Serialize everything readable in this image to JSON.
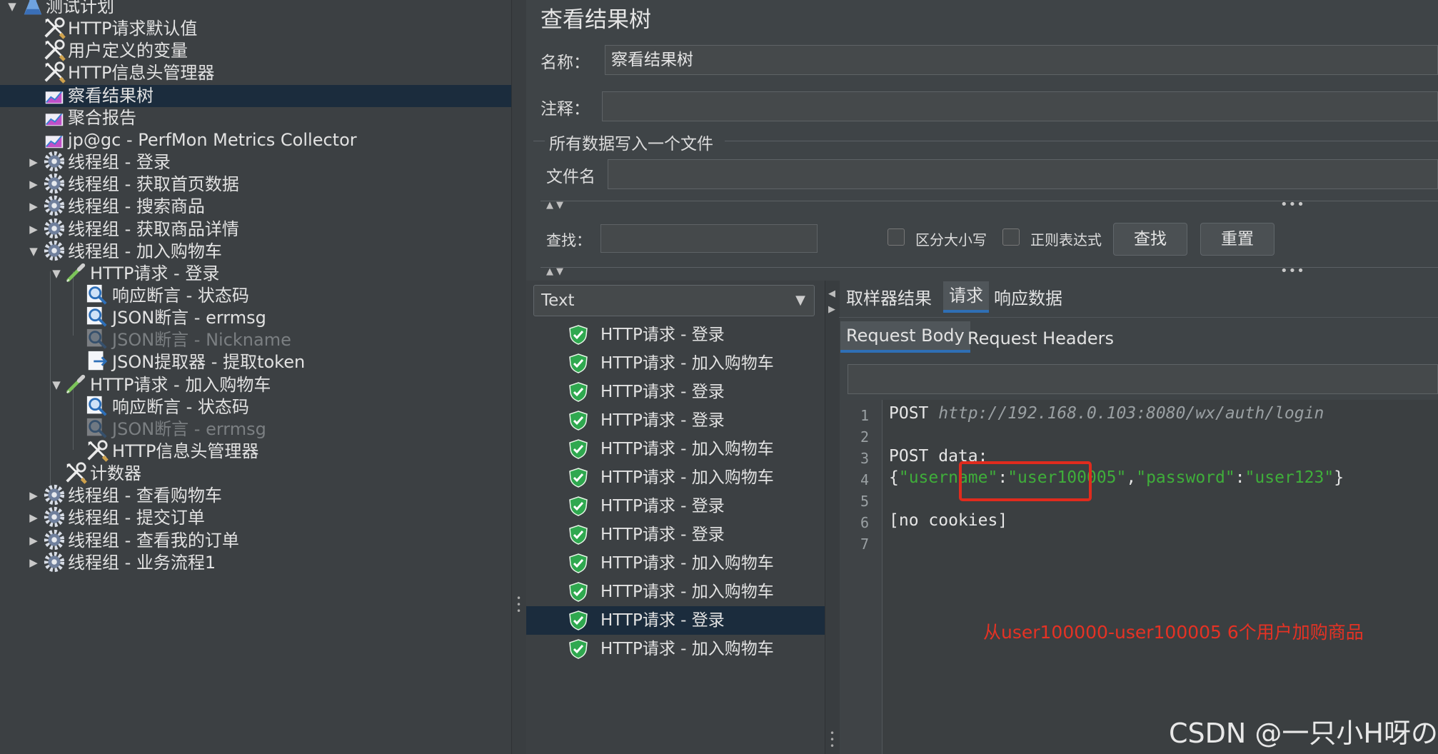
{
  "tree": {
    "items": [
      {
        "label": "测试计划",
        "icon": "flask-icon",
        "level": 0,
        "toggle": "expanded",
        "state": "normal"
      },
      {
        "label": "HTTP请求默认值",
        "icon": "tools-icon",
        "level": 1,
        "toggle": "none",
        "state": "normal"
      },
      {
        "label": "用户定义的变量",
        "icon": "tools-icon",
        "level": 1,
        "toggle": "none",
        "state": "normal"
      },
      {
        "label": "HTTP信息头管理器",
        "icon": "tools-icon",
        "level": 1,
        "toggle": "none",
        "state": "normal"
      },
      {
        "label": "察看结果树",
        "icon": "chart-icon",
        "level": 1,
        "toggle": "none",
        "state": "selected"
      },
      {
        "label": "聚合报告",
        "icon": "chart-icon",
        "level": 1,
        "toggle": "none",
        "state": "normal"
      },
      {
        "label": "jp@gc - PerfMon Metrics Collector",
        "icon": "chart-icon",
        "level": 1,
        "toggle": "none",
        "state": "normal"
      },
      {
        "label": "线程组 - 登录",
        "icon": "gear-icon",
        "level": 1,
        "toggle": "collapsed",
        "state": "normal"
      },
      {
        "label": "线程组 - 获取首页数据",
        "icon": "gear-icon",
        "level": 1,
        "toggle": "collapsed",
        "state": "normal"
      },
      {
        "label": "线程组 - 搜索商品",
        "icon": "gear-icon",
        "level": 1,
        "toggle": "collapsed",
        "state": "normal"
      },
      {
        "label": "线程组 - 获取商品详情",
        "icon": "gear-icon",
        "level": 1,
        "toggle": "collapsed",
        "state": "normal"
      },
      {
        "label": "线程组 - 加入购物车",
        "icon": "gear-icon",
        "level": 1,
        "toggle": "expanded",
        "state": "normal"
      },
      {
        "label": "HTTP请求 - 登录",
        "icon": "pipette-icon",
        "level": 2,
        "toggle": "expanded",
        "state": "normal"
      },
      {
        "label": "响应断言 - 状态码",
        "icon": "magnifier-icon",
        "level": 3,
        "toggle": "none",
        "state": "normal"
      },
      {
        "label": "JSON断言 - errmsg",
        "icon": "magnifier-icon",
        "level": 3,
        "toggle": "none",
        "state": "normal"
      },
      {
        "label": "JSON断言 - Nickname",
        "icon": "magnifier-icon",
        "level": 3,
        "toggle": "none",
        "state": "disabled"
      },
      {
        "label": "JSON提取器 - 提取token",
        "icon": "extractor-icon",
        "level": 3,
        "toggle": "none",
        "state": "normal"
      },
      {
        "label": "HTTP请求 - 加入购物车",
        "icon": "pipette-icon",
        "level": 2,
        "toggle": "expanded",
        "state": "normal"
      },
      {
        "label": "响应断言 - 状态码",
        "icon": "magnifier-icon",
        "level": 3,
        "toggle": "none",
        "state": "normal"
      },
      {
        "label": "JSON断言 - errmsg",
        "icon": "magnifier-icon",
        "level": 3,
        "toggle": "none",
        "state": "disabled"
      },
      {
        "label": "HTTP信息头管理器",
        "icon": "tools-icon",
        "level": 3,
        "toggle": "none",
        "state": "normal"
      },
      {
        "label": "计数器",
        "icon": "tools-icon",
        "level": 2,
        "toggle": "none",
        "state": "normal"
      },
      {
        "label": "线程组 - 查看购物车",
        "icon": "gear-icon",
        "level": 1,
        "toggle": "collapsed",
        "state": "normal"
      },
      {
        "label": "线程组 - 提交订单",
        "icon": "gear-icon",
        "level": 1,
        "toggle": "collapsed",
        "state": "normal"
      },
      {
        "label": "线程组 - 查看我的订单",
        "icon": "gear-icon",
        "level": 1,
        "toggle": "collapsed",
        "state": "normal"
      },
      {
        "label": "线程组 - 业务流程1",
        "icon": "gear-icon",
        "level": 1,
        "toggle": "collapsed",
        "state": "normal"
      }
    ]
  },
  "panel": {
    "title": "查看结果树",
    "name_label": "名称：",
    "name_value": "察看结果树",
    "comment_label": "注释：",
    "comment_value": "",
    "file_section_label": "所有数据写入一个文件",
    "filename_label": "文件名",
    "filename_value": ""
  },
  "search": {
    "label": "查找：",
    "value": "",
    "case_sensitive_label": "区分大小写",
    "regex_label": "正则表达式",
    "find_button": "查找",
    "reset_button": "重置"
  },
  "results": {
    "renderer": "Text",
    "items": [
      {
        "label": "HTTP请求 - 登录",
        "selected": false
      },
      {
        "label": "HTTP请求 - 加入购物车",
        "selected": false
      },
      {
        "label": "HTTP请求 - 登录",
        "selected": false
      },
      {
        "label": "HTTP请求 - 登录",
        "selected": false
      },
      {
        "label": "HTTP请求 - 加入购物车",
        "selected": false
      },
      {
        "label": "HTTP请求 - 加入购物车",
        "selected": false
      },
      {
        "label": "HTTP请求 - 登录",
        "selected": false
      },
      {
        "label": "HTTP请求 - 登录",
        "selected": false
      },
      {
        "label": "HTTP请求 - 加入购物车",
        "selected": false
      },
      {
        "label": "HTTP请求 - 加入购物车",
        "selected": false
      },
      {
        "label": "HTTP请求 - 登录",
        "selected": true
      },
      {
        "label": "HTTP请求 - 加入购物车",
        "selected": false
      }
    ]
  },
  "detail": {
    "tabs": [
      "取样器结果",
      "请求",
      "响应数据"
    ],
    "active_tab": "请求",
    "subtabs": [
      "Request Body",
      "Request Headers"
    ],
    "active_subtab": "Request Body",
    "line_numbers": [
      "1",
      "2",
      "3",
      "4",
      "5",
      "6",
      "7"
    ],
    "code": {
      "l1_method": "POST ",
      "l1_url": "http://192.168.0.103:8080/wx/auth/login",
      "l3": "POST data:",
      "l4_open": "{",
      "l4_key1": "\"username\"",
      "l4_colon1": ":",
      "l4_val1": "\"user100005\"",
      "l4_comma": ",",
      "l4_key2": "\"password\"",
      "l4_colon2": ":",
      "l4_val2": "\"user123\"",
      "l4_close": "}",
      "l6": "[no cookies]"
    }
  },
  "annotation": {
    "note": "从user100000-user100005 6个用户加购商品",
    "color": "#e53224"
  },
  "watermark": "CSDN @一只小H呀の",
  "colors": {
    "selection": "#1b2c3d",
    "json_string": "#3fae3a",
    "active_tab_underline": "#2f6fb5",
    "success_shield": "#2fa84f"
  }
}
